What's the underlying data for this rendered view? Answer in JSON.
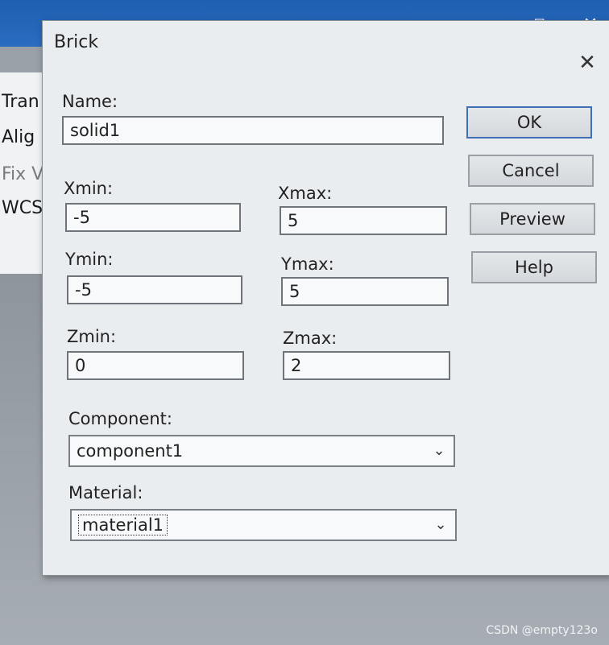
{
  "background_window": {
    "controls": {
      "minimize": "–",
      "restore": "⧉",
      "close": "✕"
    },
    "panel_items": [
      "Tran",
      "Alig",
      "Fix V",
      "WCS"
    ]
  },
  "dialog": {
    "title": "Brick",
    "close_icon": "✕",
    "name": {
      "label": "Name:",
      "value": "solid1"
    },
    "xmin": {
      "label": "Xmin:",
      "value": "-5"
    },
    "xmax": {
      "label": "Xmax:",
      "value": "5"
    },
    "ymin": {
      "label": "Ymin:",
      "value": "-5"
    },
    "ymax": {
      "label": "Ymax:",
      "value": "5"
    },
    "zmin": {
      "label": "Zmin:",
      "value": "0"
    },
    "zmax": {
      "label": "Zmax:",
      "value": "2"
    },
    "component": {
      "label": "Component:",
      "value": "component1"
    },
    "material": {
      "label": "Material:",
      "value": "material1"
    },
    "buttons": {
      "ok": "OK",
      "cancel": "Cancel",
      "preview": "Preview",
      "help": "Help"
    }
  },
  "watermark": "CSDN @empty123o",
  "colors": {
    "title_bar": "#2a6cc0",
    "dialog_bg": "#eaedf0",
    "default_button_border": "#3f6fb5"
  }
}
